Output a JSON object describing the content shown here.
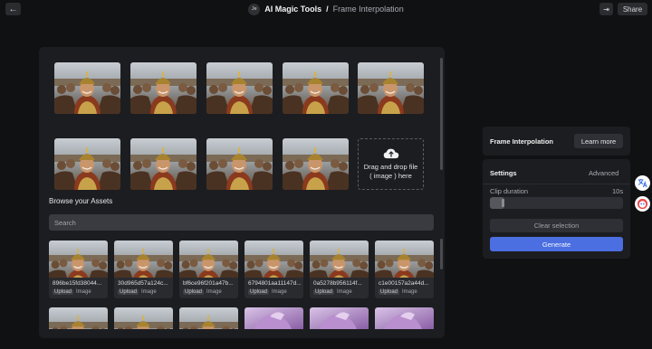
{
  "header": {
    "back_icon": "arrow-left-icon",
    "avatar_initials": "Je",
    "app_name": "AI Magic Tools",
    "separator": "/",
    "page_name": "Frame Interpolation",
    "exit_icon": "exit-icon",
    "share_label": "Share"
  },
  "frames": {
    "count": 9,
    "drop_zone": {
      "icon": "cloud-upload-icon",
      "line1": "Drag and drop file",
      "line2": "( image ) here"
    }
  },
  "assets": {
    "title": "Browse your Assets",
    "search_placeholder": "Search",
    "items": [
      {
        "name": "896be15fd38044...",
        "source": "Upload",
        "type": "Image"
      },
      {
        "name": "30d965d57a124c...",
        "source": "Upload",
        "type": "Image"
      },
      {
        "name": "bf6ce96f201a47b...",
        "source": "Upload",
        "type": "Image"
      },
      {
        "name": "6794801aa11147d...",
        "source": "Upload",
        "type": "Image"
      },
      {
        "name": "0a5278b956114f...",
        "source": "Upload",
        "type": "Image"
      },
      {
        "name": "c1e00157a2a44d...",
        "source": "Upload",
        "type": "Image"
      }
    ]
  },
  "sidebar": {
    "frame_interp_title": "Frame Interpolation",
    "learn_more_label": "Learn more",
    "settings_title": "Settings",
    "advanced_label": "Advanced",
    "clip_duration_label": "Clip duration",
    "clip_duration_value": "10s",
    "clear_selection_label": "Clear selection",
    "generate_label": "Generate",
    "accent_color": "#4b6fe0"
  },
  "float_icons": [
    "translate-icon",
    "assistant-icon"
  ]
}
